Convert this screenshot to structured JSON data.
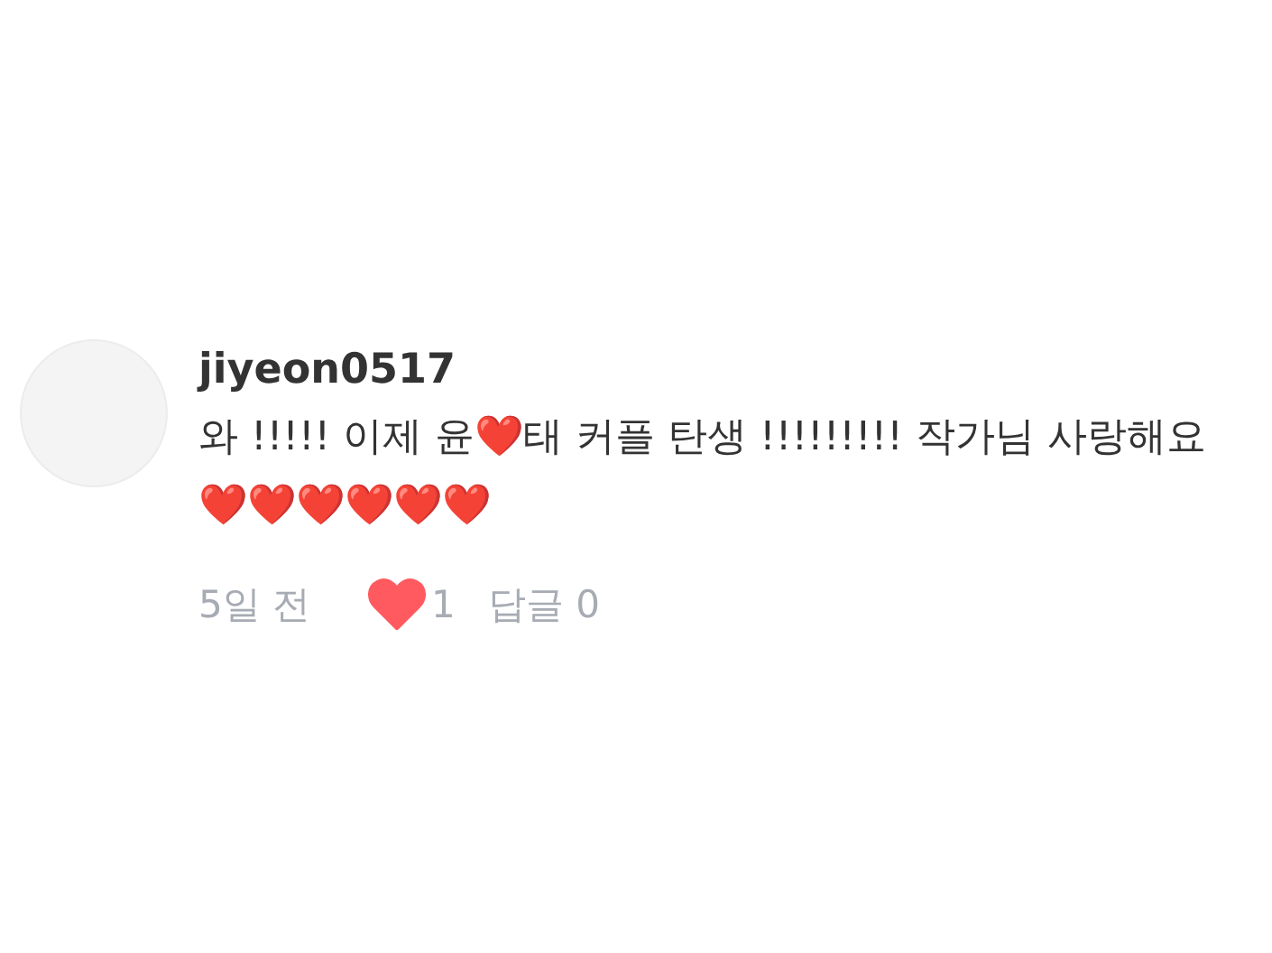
{
  "comment": {
    "username": "jiyeon0517",
    "body": "와 !!!!! 이제 윤❤️태 커플 탄생 !!!!!!!!! 작가님 사랑해요 ❤️❤️❤️❤️❤️❤️",
    "time": "5일 전",
    "liked": true,
    "like_count": "1",
    "reply_label": "답글 0"
  }
}
